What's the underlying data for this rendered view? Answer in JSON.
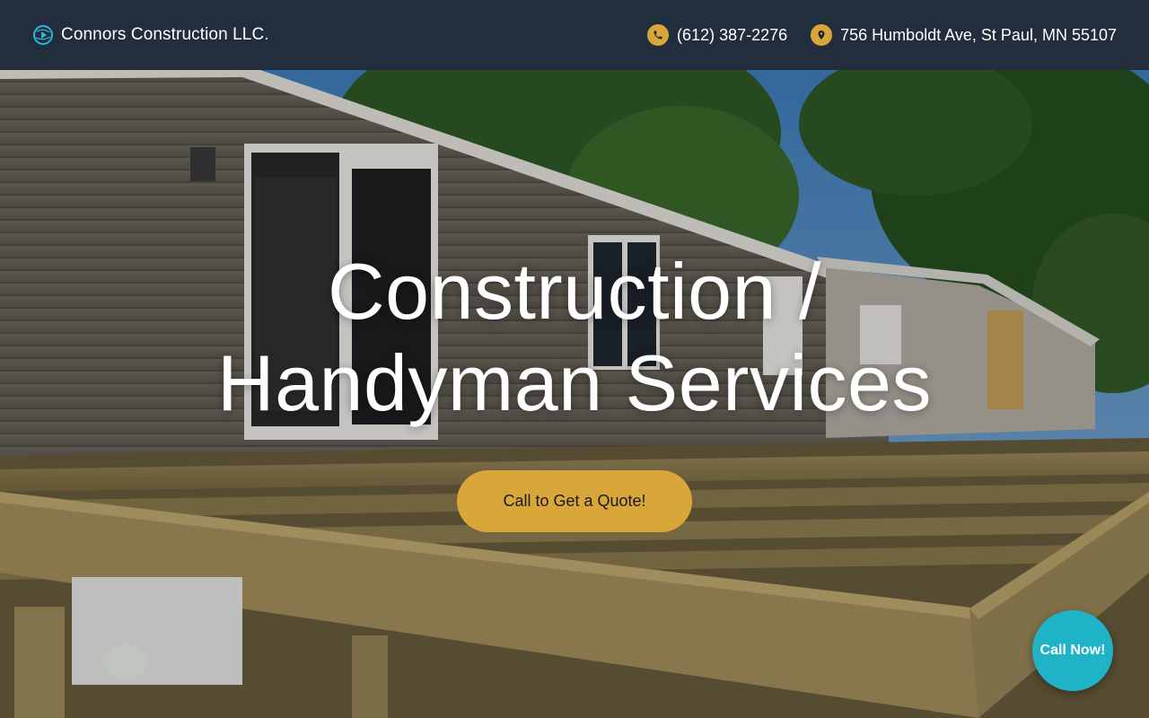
{
  "header": {
    "brand_name": "Connors Construction LLC.",
    "phone": "(612) 387-2276",
    "address": "756 Humboldt Ave, St Paul, MN 55107",
    "icons": {
      "logo": "globe-play-icon",
      "phone": "phone-icon",
      "address": "map-pin-icon"
    }
  },
  "hero": {
    "title": "Construction / Handyman Services",
    "cta_label": "Call to Get a Quote!",
    "background": "house-with-deck-framing-photo"
  },
  "floating_button": {
    "label": "Call Now!"
  },
  "colors": {
    "header_bg": "#222d3d",
    "accent": "#d9a63a",
    "call_button": "#1fb3c7"
  }
}
